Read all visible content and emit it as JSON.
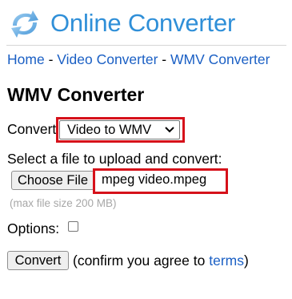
{
  "header": {
    "logo_icon": "refresh-arrows-icon",
    "logo_text": "Online Converter"
  },
  "breadcrumb": {
    "items": [
      "Home",
      "Video Converter",
      "WMV Converter"
    ],
    "separator": "-"
  },
  "page": {
    "title": "WMV Converter"
  },
  "form": {
    "convert_label": "Convert",
    "convert_select_value": "Video to WMV",
    "upload_label": "Select a file to upload and convert:",
    "choose_file_label": "Choose File",
    "chosen_file_name": "mpeg video.mpeg",
    "max_size_note": "(max file size 200 MB)",
    "options_label": "Options:",
    "options_checked": false,
    "submit_label": "Convert",
    "confirm_prefix": "(confirm you agree to",
    "terms_link": "terms",
    "confirm_suffix": ")"
  },
  "colors": {
    "brand": "#2f8fd8",
    "link": "#1a5fc4",
    "highlight": "#d6111a",
    "muted": "#a7a7a7"
  }
}
